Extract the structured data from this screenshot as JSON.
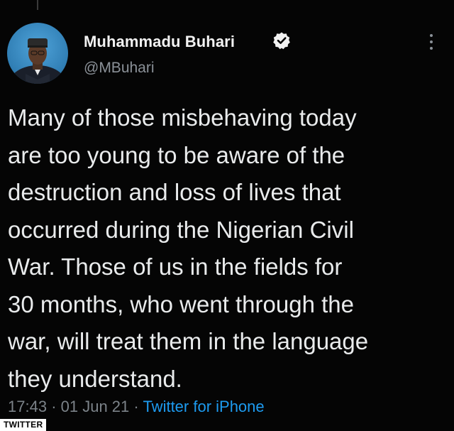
{
  "tweet": {
    "author": {
      "display_name": "Muhammadu Buhari",
      "handle": "@MBuhari",
      "verified": true
    },
    "text": "Many of those misbehaving today\nare too young to be aware of the\ndestruction and loss of lives that\noccurred during the Nigerian Civil\nWar. Those of us in the fields for\n30 months, who went through the\nwar, will treat them in the language\nthey understand.",
    "time": "17:43",
    "date": "01 Jun 21",
    "separator": "·",
    "source": "Twitter for iPhone"
  },
  "icons": {
    "verified": "verified-badge-icon",
    "more": "more-vertical-icon"
  },
  "watermark": {
    "label": "TWITTER"
  },
  "colors": {
    "background": "#000000",
    "text": "#e9ebec",
    "muted": "#7c8389",
    "link": "#1d9bf0"
  }
}
